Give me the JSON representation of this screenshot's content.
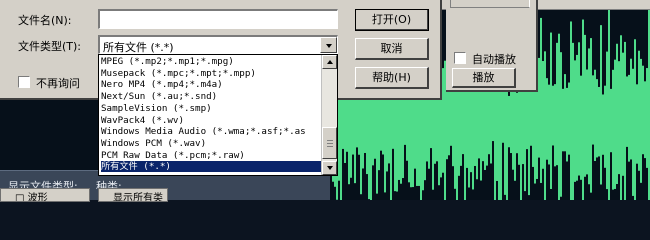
{
  "dialog": {
    "filename_label": "文件名(N):",
    "filename_value": "",
    "filetype_label": "文件类型(T):",
    "filetype_selected": "所有文件  (*.*)",
    "no_ask_label": "不再询问",
    "open_button": "打开(O)",
    "cancel_button": "取消",
    "help_button": "帮助(H)"
  },
  "right_panel": {
    "autoplay_label": "自动播放",
    "play_button": "播放"
  },
  "dropdown": {
    "items": [
      "MPEG (*.mp2;*.mp1;*.mpg)",
      "Musepack (*.mpc;*.mpt;*.mpp)",
      "Nero MP4 (*.mp4;*.m4a)",
      "Next/Sun (*.au;*.snd)",
      "SampleVision (*.smp)",
      "WavPack4 (*.wv)",
      "Windows Media Audio (*.wma;*.asf;*.as",
      "Windows PCM (*.wav)",
      "PCM Raw Data (*.pcm;*.raw)",
      "所有文件  (*.*)"
    ],
    "selected_index": 9
  },
  "status": {
    "display_type_label": "显示文件类型:",
    "kind_label": "种类:",
    "sub_left": "□ 波形",
    "sub_right": "显示所有类型"
  },
  "colors": {
    "waveform": "#4fdc8a",
    "selection": "#0a246a",
    "dialog_face": "#d4d0c8"
  }
}
